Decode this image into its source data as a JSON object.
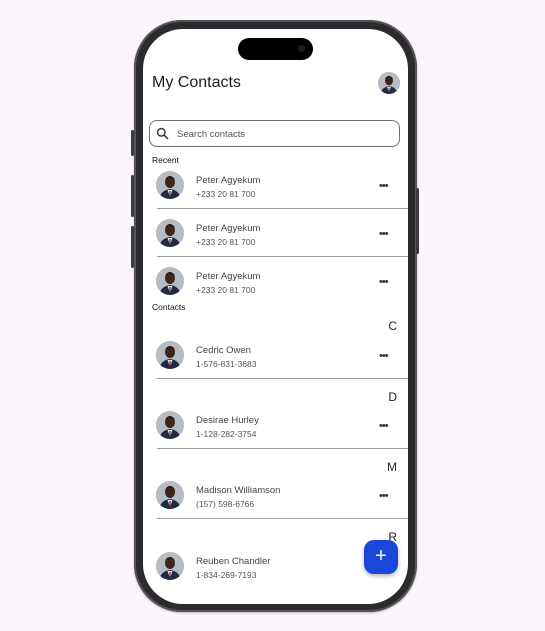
{
  "header": {
    "title": "My Contacts",
    "profile_icon": "user-avatar-icon"
  },
  "search": {
    "placeholder": "Search contacts",
    "icon": "search-icon"
  },
  "recent": {
    "label": "Recent",
    "items": [
      {
        "name": "Peter Agyekum",
        "phone": "+233 20 81 700"
      },
      {
        "name": "Peter Agyekum",
        "phone": "+233 20 81 700"
      },
      {
        "name": "Peter Agyekum",
        "phone": "+233 20 81 700"
      }
    ]
  },
  "contacts": {
    "label": "Contacts",
    "groups": [
      {
        "letter": "C",
        "items": [
          {
            "name": "Cedric Owen",
            "phone": "1-576-831-3683"
          }
        ]
      },
      {
        "letter": "D",
        "items": [
          {
            "name": "Desirae Hurley",
            "phone": "1-128-282-3754"
          }
        ]
      },
      {
        "letter": "M",
        "items": [
          {
            "name": "Madison Williamson",
            "phone": "(157) 598-6766"
          }
        ]
      },
      {
        "letter": "R",
        "items": [
          {
            "name": "Reuben Chandler",
            "phone": "1-834-269-7193"
          }
        ]
      }
    ]
  },
  "more_glyph": "•••",
  "fab": {
    "label": "+",
    "icon": "add-icon",
    "color": "#1a47d9"
  }
}
